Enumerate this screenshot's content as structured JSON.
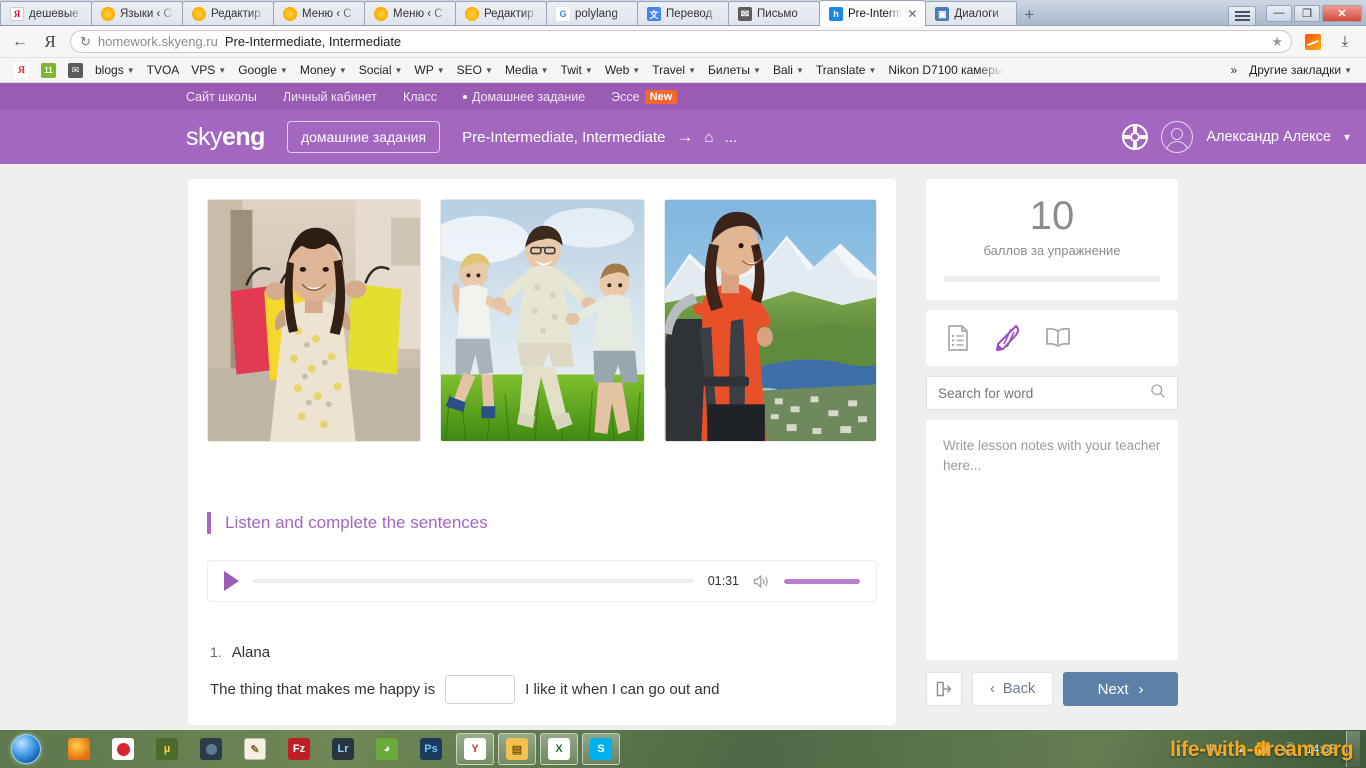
{
  "browser": {
    "tabs": [
      {
        "title": "дешевые",
        "favicon": "yandex-icon",
        "active": false
      },
      {
        "title": "Языки ‹ С",
        "favicon": "sun-icon",
        "active": false
      },
      {
        "title": "Редактир",
        "favicon": "sun-icon",
        "active": false
      },
      {
        "title": "Меню ‹ С",
        "favicon": "sun-icon",
        "active": false
      },
      {
        "title": "Меню ‹ С",
        "favicon": "sun-icon",
        "active": false
      },
      {
        "title": "Редактир",
        "favicon": "sun-icon",
        "active": false
      },
      {
        "title": "polylang",
        "favicon": "google-icon",
        "active": false
      },
      {
        "title": "Перевод",
        "favicon": "google-translate-icon",
        "active": false
      },
      {
        "title": "Письмо",
        "favicon": "mail-icon",
        "active": false
      },
      {
        "title": "Pre-Interm",
        "favicon": "skyeng-icon",
        "active": true
      },
      {
        "title": "Диалоги",
        "favicon": "dialogs-icon",
        "active": false
      }
    ],
    "new_tab_label": "+",
    "window_controls": {
      "minimize": "—",
      "maximize": "❐",
      "close": "✕",
      "menu": "menu-icon"
    },
    "address": {
      "host": "homework.skyeng.ru",
      "title": "Pre-Intermediate, Intermediate",
      "reload_label": "↻",
      "back_label": "←",
      "star_label": "★"
    },
    "bookmarks": [
      {
        "label": "",
        "icon": "yandex-icon",
        "caret": false
      },
      {
        "label": "",
        "icon": "metrika-icon",
        "caret": false
      },
      {
        "label": "",
        "icon": "mail-icon",
        "caret": false
      },
      {
        "label": "blogs",
        "icon": "",
        "caret": true
      },
      {
        "label": "TVOA",
        "icon": "",
        "caret": false
      },
      {
        "label": "VPS",
        "icon": "",
        "caret": true
      },
      {
        "label": "Google",
        "icon": "",
        "caret": true
      },
      {
        "label": "Money",
        "icon": "",
        "caret": true
      },
      {
        "label": "Social",
        "icon": "",
        "caret": true
      },
      {
        "label": "WP",
        "icon": "",
        "caret": true
      },
      {
        "label": "SEO",
        "icon": "",
        "caret": true
      },
      {
        "label": "Media",
        "icon": "",
        "caret": true
      },
      {
        "label": "Twit",
        "icon": "",
        "caret": true
      },
      {
        "label": "Web",
        "icon": "",
        "caret": true
      },
      {
        "label": "Travel",
        "icon": "",
        "caret": true
      },
      {
        "label": "Билеты",
        "icon": "",
        "caret": true
      },
      {
        "label": "Bali",
        "icon": "",
        "caret": true
      },
      {
        "label": "Translate",
        "icon": "",
        "caret": true
      },
      {
        "label": "Nikon D7100 камеры",
        "icon": "",
        "caret": false
      }
    ],
    "bookmarks_overflow": "»",
    "other_bookmarks": "Другие закладки"
  },
  "site": {
    "topnav": [
      {
        "label": "Сайт школы",
        "dot": false,
        "badge": ""
      },
      {
        "label": "Личный кабинет",
        "dot": false,
        "badge": ""
      },
      {
        "label": "Класс",
        "dot": false,
        "badge": ""
      },
      {
        "label": "Домашнее задание",
        "dot": true,
        "badge": ""
      },
      {
        "label": "Эссе",
        "dot": false,
        "badge": "New"
      }
    ],
    "logo_sky": "sky",
    "logo_eng": "eng",
    "hw_pill": "домашние задания",
    "course_title": "Pre-Intermediate, Intermediate",
    "course_arrow": "→",
    "course_suffix": "...",
    "user_name": "Александр Алексе",
    "accent_purple": "#a367c0",
    "accent_purple_dark": "#9a5cb3"
  },
  "exercise": {
    "images": [
      {
        "alt": "smiling-woman-with-shopping-bags"
      },
      {
        "alt": "father-running-with-two-children-in-field"
      },
      {
        "alt": "woman-hiker-with-backpack-in-mountains"
      }
    ],
    "heading": "Listen and complete the sentences",
    "player": {
      "play_label": "▶",
      "time": "01:31",
      "volume_icon": "speaker-icon"
    },
    "questions": [
      {
        "number": "1.",
        "speaker": "Alana",
        "text_before": "The thing that makes me happy is",
        "blank_value": "",
        "text_after": "I like it when I can go out and"
      }
    ]
  },
  "sidebar": {
    "score_value": "10",
    "score_label": "баллов за упражнение",
    "tools": [
      {
        "name": "task-list-icon",
        "active": false
      },
      {
        "name": "pencil-icon",
        "active": true
      },
      {
        "name": "dictionary-book-icon",
        "active": false
      }
    ],
    "search_placeholder": "Search for word",
    "search_value": "",
    "notes_placeholder": "Write lesson notes with your teacher here...",
    "notes_value": "",
    "exit_label": "exit-icon",
    "back_label": "Back",
    "next_label": "Next",
    "next_color": "#5d80a8"
  },
  "taskbar": {
    "start_label": "start-orb",
    "items": [
      {
        "name": "firefox-icon"
      },
      {
        "name": "opera-icon"
      },
      {
        "name": "utorrent-icon"
      },
      {
        "name": "camera-icon"
      },
      {
        "name": "notepad-icon"
      },
      {
        "name": "filezilla-icon",
        "text": "Fz"
      },
      {
        "name": "lightroom-icon",
        "text": "Lr"
      },
      {
        "name": "evernote-icon"
      },
      {
        "name": "photoshop-icon",
        "text": "Ps"
      },
      {
        "name": "yandex-browser-icon",
        "text": "Y"
      },
      {
        "name": "explorer-icon"
      },
      {
        "name": "excel-icon",
        "text": "X"
      },
      {
        "name": "skype-icon",
        "text": "S"
      }
    ],
    "language": "RU",
    "time": "14:55",
    "watermark": "life-with-dream.org"
  }
}
